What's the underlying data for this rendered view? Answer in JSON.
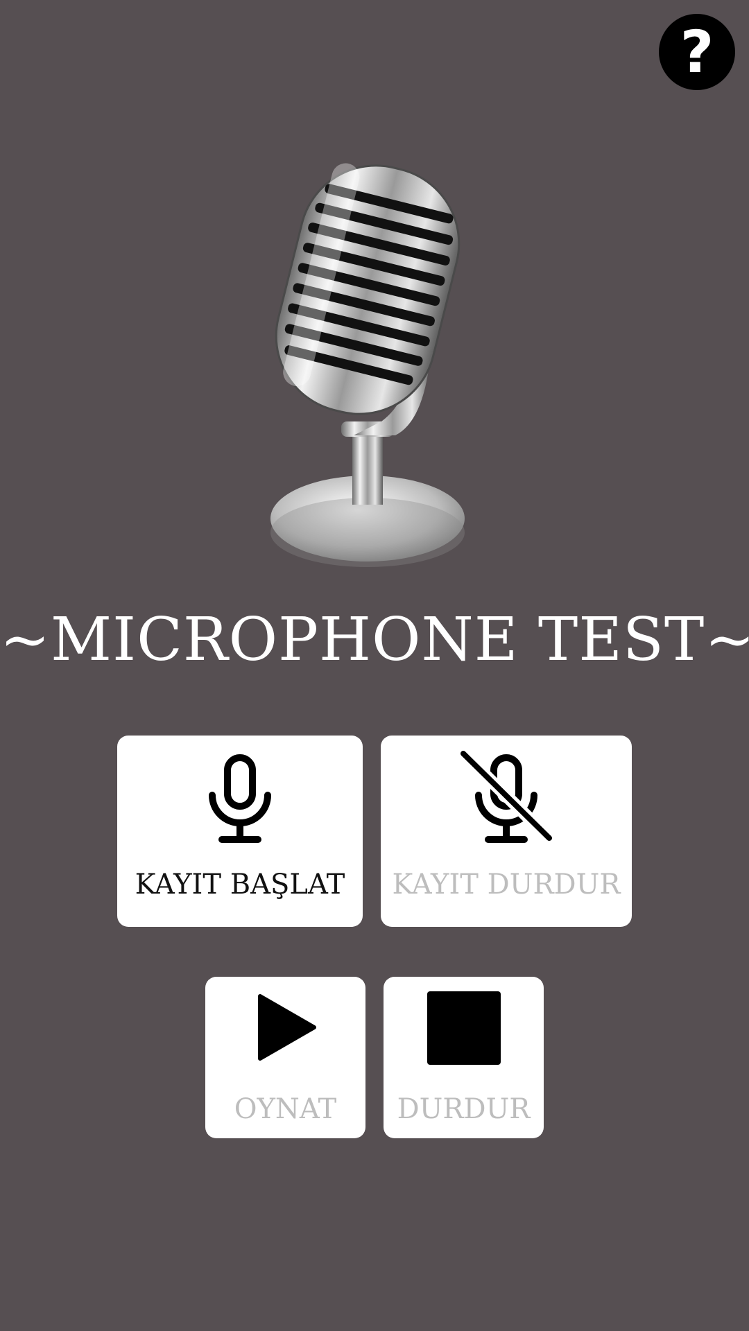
{
  "help": {
    "label": "?"
  },
  "title": "~MICROPHONE TEST~",
  "buttons": {
    "record_start": {
      "label": "KAYIT BAŞLAT",
      "icon": "microphone-icon",
      "enabled": true
    },
    "record_stop": {
      "label": "KAYIT DURDUR",
      "icon": "microphone-off-icon",
      "enabled": false
    },
    "play": {
      "label": "OYNAT",
      "icon": "play-icon",
      "enabled": false
    },
    "stop": {
      "label": "DURDUR",
      "icon": "stop-icon",
      "enabled": false
    }
  },
  "colors": {
    "background": "#564f52",
    "card": "#ffffff",
    "label_active": "#111111",
    "label_disabled": "#bdbdbd"
  }
}
